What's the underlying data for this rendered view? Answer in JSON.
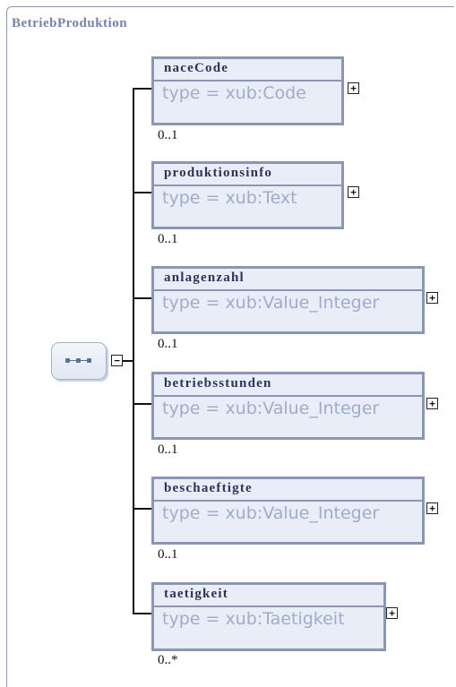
{
  "diagram": {
    "title": "BetriebProduktion",
    "elements": [
      {
        "name": "naceCode",
        "type": "type = xub:Code",
        "cardinality": "0..1"
      },
      {
        "name": "produktionsinfo",
        "type": "type = xub:Text",
        "cardinality": "0..1"
      },
      {
        "name": "anlagenzahl",
        "type": "type = xub:Value_Integer",
        "cardinality": "0..1"
      },
      {
        "name": "betriebsstunden",
        "type": "type = xub:Value_Integer",
        "cardinality": "0..1"
      },
      {
        "name": "beschaeftigte",
        "type": "type = xub:Value_Integer",
        "cardinality": "0..1"
      },
      {
        "name": "taetigkeit",
        "type": "type = xub:Taetigkeit",
        "cardinality": "0..*"
      }
    ],
    "expand_symbol": "+",
    "collapse_symbol": "−"
  }
}
